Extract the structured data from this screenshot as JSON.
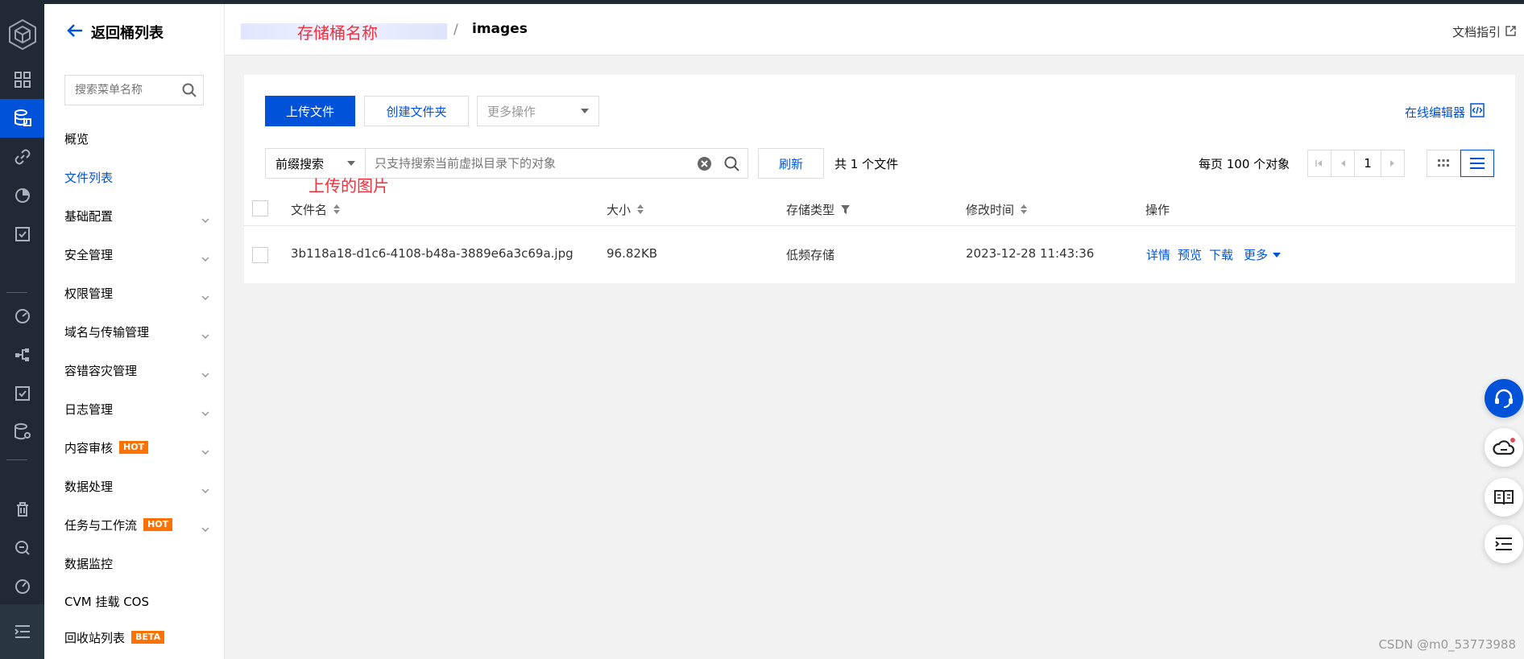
{
  "breadcrumb": {
    "bucket_name": "存储桶名称",
    "separator": "/",
    "current": "images"
  },
  "header": {
    "docs_link": "文档指引"
  },
  "sidebar": {
    "back_label": "返回桶列表",
    "search_placeholder": "搜索菜单名称",
    "items": [
      {
        "label": "概览",
        "expandable": false
      },
      {
        "label": "文件列表",
        "expandable": false,
        "selected": true
      },
      {
        "label": "基础配置",
        "expandable": true
      },
      {
        "label": "安全管理",
        "expandable": true
      },
      {
        "label": "权限管理",
        "expandable": true
      },
      {
        "label": "域名与传输管理",
        "expandable": true
      },
      {
        "label": "容错容灾管理",
        "expandable": true
      },
      {
        "label": "日志管理",
        "expandable": true
      },
      {
        "label": "内容审核",
        "expandable": true,
        "tag": "HOT"
      },
      {
        "label": "数据处理",
        "expandable": true
      },
      {
        "label": "任务与工作流",
        "expandable": true,
        "tag": "HOT"
      },
      {
        "label": "数据监控",
        "expandable": false
      },
      {
        "label": "CVM 挂载 COS",
        "expandable": false
      },
      {
        "label": "回收站列表",
        "expandable": false,
        "tag": "BETA"
      }
    ]
  },
  "toolbar": {
    "upload_label": "上传文件",
    "create_folder_label": "创建文件夹",
    "more_actions_label": "更多操作",
    "online_editor_label": "在线编辑器"
  },
  "search": {
    "mode_label": "前缀搜索",
    "placeholder": "只支持搜索当前虚拟目录下的对象",
    "refresh_label": "刷新",
    "count_text": "共 1 个文件",
    "per_page_text": "每页 100 个对象",
    "page_number": "1"
  },
  "table": {
    "columns": [
      "文件名",
      "大小",
      "存储类型",
      "修改时间",
      "操作"
    ],
    "rows": [
      {
        "name": "3b118a18-d1c6-4108-b48a-3889e6a3c69a.jpg",
        "size": "96.82KB",
        "storage_class": "低频存储",
        "modified": "2023-12-28 11:43:36",
        "actions": [
          "详情",
          "预览",
          "下载",
          "更多"
        ]
      }
    ]
  },
  "annotation": "上传的图片",
  "watermark": "CSDN @m0_53773988",
  "colors": {
    "primary": "#0052d9",
    "rail_bg": "#1f2a36",
    "hot_tag": "#ff7200",
    "annotation": "#f0303b"
  }
}
